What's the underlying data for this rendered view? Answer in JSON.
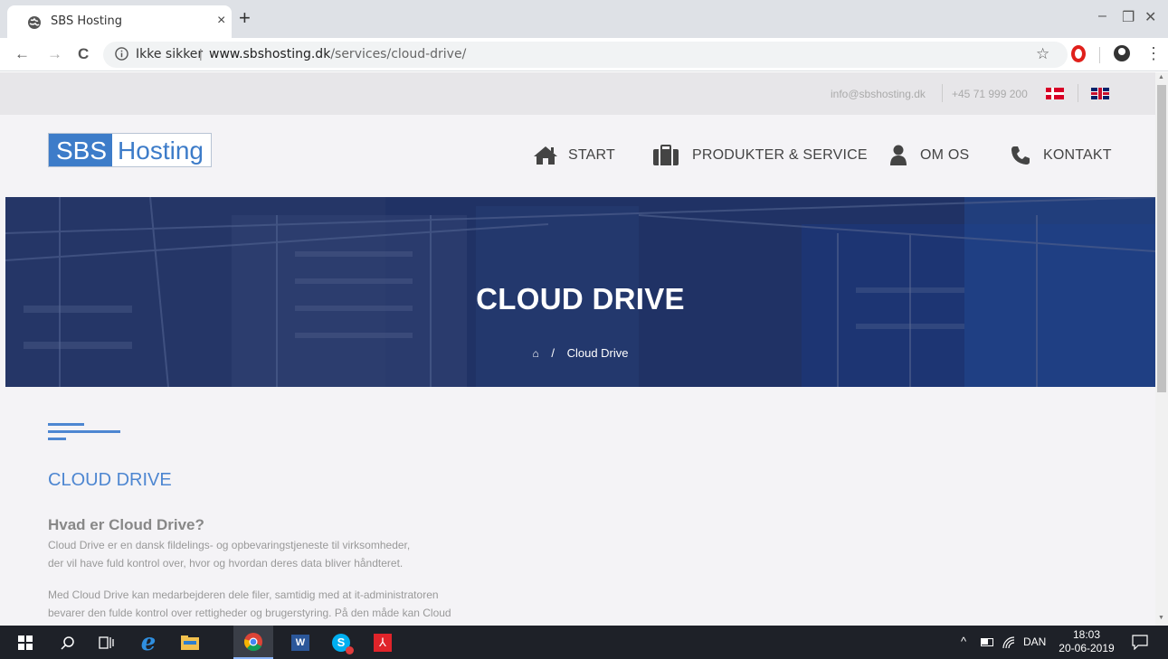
{
  "browser": {
    "tab_title": "SBS Hosting",
    "tab_close": "×",
    "new_tab": "+",
    "win_minimize": "–",
    "win_restore": "❐",
    "win_close": "✕",
    "nav_back": "←",
    "nav_forward": "→",
    "nav_reload": "C",
    "security_label": "Ikke sikker",
    "url_separator": "|",
    "url_host": "www.sbshosting.dk",
    "url_path": "/services/cloud-drive/",
    "icons": [
      "globe-icon",
      "info-icon",
      "star-icon",
      "opera-icon",
      "profile-icon",
      "menu-icon"
    ]
  },
  "topbar": {
    "email": "info@sbshosting.dk",
    "phone": "+45 71 999 200"
  },
  "header": {
    "logo_part1": "SBS",
    "logo_part2": "Hosting",
    "nav": [
      {
        "label": "START",
        "icon": "home-icon"
      },
      {
        "label": "PRODUKTER & SERVICE",
        "icon": "briefcase-icon"
      },
      {
        "label": "OM OS",
        "icon": "user-icon"
      },
      {
        "label": "KONTAKT",
        "icon": "phone-icon"
      }
    ]
  },
  "hero": {
    "title": "CLOUD DRIVE",
    "breadcrumb_sep": "/",
    "breadcrumb_current": "Cloud Drive"
  },
  "content": {
    "title": "CLOUD DRIVE",
    "subheading": "Hvad er Cloud Drive?",
    "para1_line1": "Cloud Drive er en dansk fildelings- og opbevaringstjeneste til virksomheder,",
    "para1_line2": "der vil have fuld kontrol over, hvor og hvordan deres data bliver håndteret.",
    "para2_line1": "Med Cloud Drive kan medarbejderen dele filer, samtidig med at it-administratoren",
    "para2_line2": "bevarer den fulde kontrol over rettigheder og brugerstyring. På den måde kan Cloud"
  },
  "taskbar": {
    "lang": "DAN",
    "time": "18:03",
    "date": "20-06-2019",
    "up_arrow": "^",
    "word_label": "W"
  },
  "colors": {
    "accent": "#4d86d1",
    "logo_blue": "#3d7cc9",
    "taskbar": "#1e2128"
  }
}
